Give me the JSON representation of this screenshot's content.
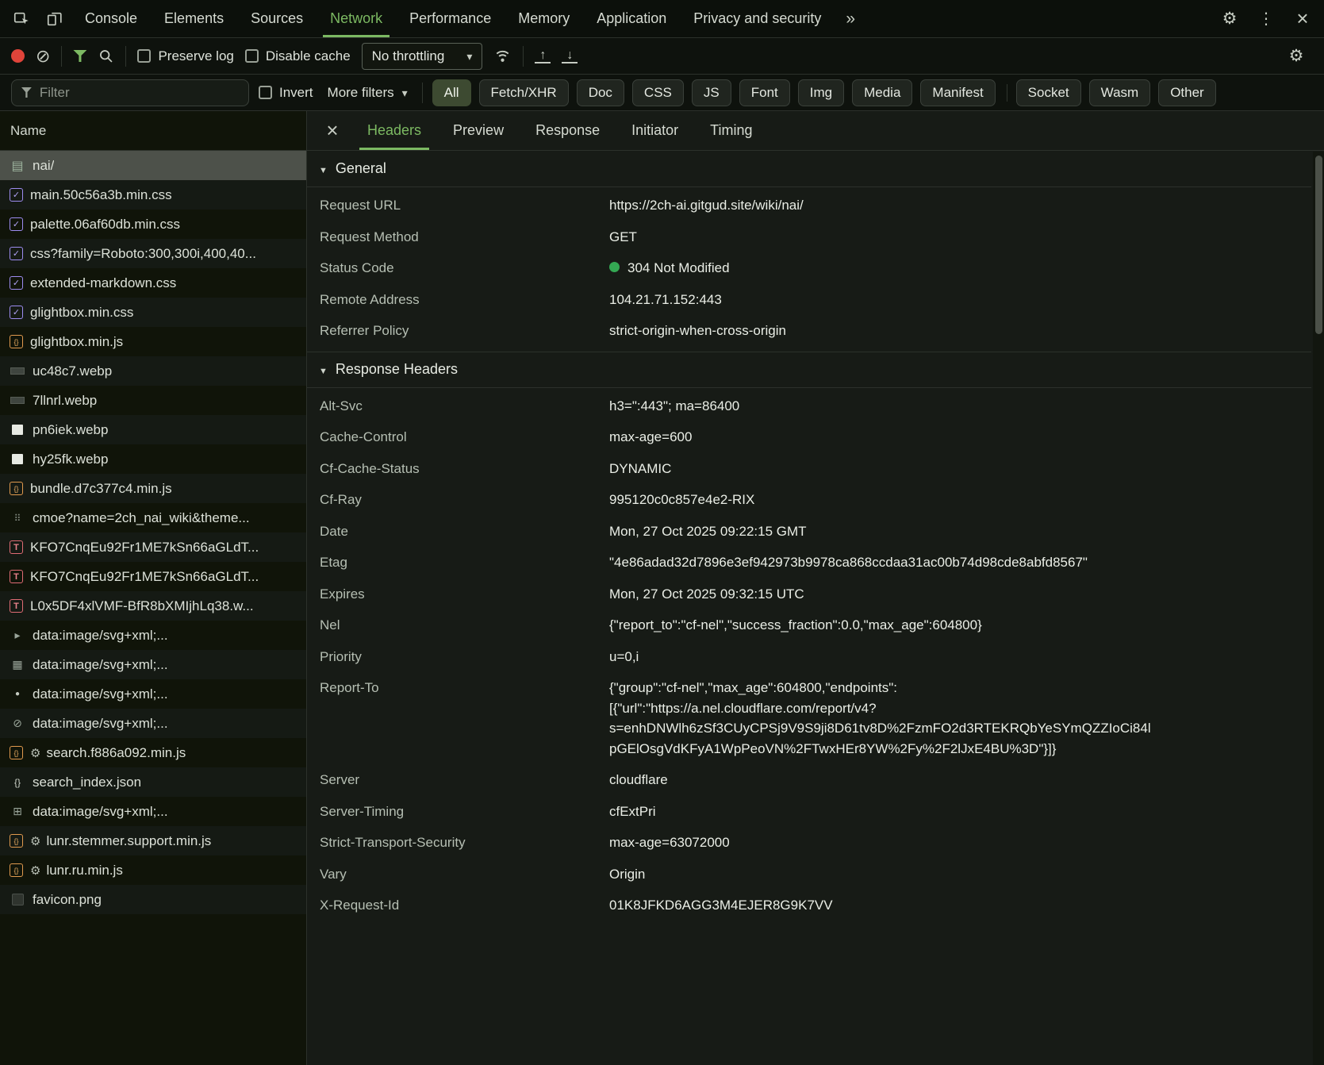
{
  "colors": {
    "accent_green": "#7cb962",
    "record_red": "#e0443a",
    "status_green": "#34a853",
    "selected_row": "#4d514a"
  },
  "icons": {
    "inspect": "cursor-in-box",
    "device_toolbar": "phone-tablet",
    "record": "filled-red-circle",
    "clear": "circle-slash",
    "filter": "green-funnel",
    "search": "magnifier",
    "network_conditions": "wifi",
    "import_har": "arrow-up-tray",
    "export_har": "arrow-down-tray",
    "settings": "gear",
    "more_options": "kebab",
    "close": "x",
    "section_caret": "triangle-down"
  },
  "top_bar": {
    "tabs": [
      {
        "label": "Console"
      },
      {
        "label": "Elements"
      },
      {
        "label": "Sources"
      },
      {
        "label": "Network",
        "active": true
      },
      {
        "label": "Performance"
      },
      {
        "label": "Memory"
      },
      {
        "label": "Application"
      },
      {
        "label": "Privacy and security"
      }
    ]
  },
  "network_toolbar": {
    "preserve_log_label": "Preserve log",
    "disable_cache_label": "Disable cache",
    "throttling_value": "No throttling"
  },
  "filter_bar": {
    "filter_placeholder": "Filter",
    "invert_label": "Invert",
    "more_filters_label": "More filters",
    "type_filters": [
      {
        "label": "All",
        "active": true
      },
      {
        "label": "Fetch/XHR"
      },
      {
        "label": "Doc"
      },
      {
        "label": "CSS"
      },
      {
        "label": "JS"
      },
      {
        "label": "Font"
      },
      {
        "label": "Img"
      },
      {
        "label": "Media"
      },
      {
        "label": "Manifest"
      },
      {
        "label": "Socket",
        "divided": true
      },
      {
        "label": "Wasm"
      },
      {
        "label": "Other"
      }
    ]
  },
  "request_list": {
    "name_header": "Name",
    "items": [
      {
        "name": "nai/",
        "icon": "document-icon",
        "selected": true
      },
      {
        "name": "main.50c56a3b.min.css",
        "icon": "stylesheet-icon"
      },
      {
        "name": "palette.06af60db.min.css",
        "icon": "stylesheet-icon"
      },
      {
        "name": "css?family=Roboto:300,300i,400,40...",
        "icon": "stylesheet-icon"
      },
      {
        "name": "extended-markdown.css",
        "icon": "stylesheet-icon"
      },
      {
        "name": "glightbox.min.css",
        "icon": "stylesheet-icon"
      },
      {
        "name": "glightbox.min.js",
        "icon": "script-icon"
      },
      {
        "name": "uc48c7.webp",
        "icon": "image-thumb-dark-icon"
      },
      {
        "name": "7llnrl.webp",
        "icon": "image-thumb-dark-icon"
      },
      {
        "name": "pn6iek.webp",
        "icon": "image-thumb-light-icon"
      },
      {
        "name": "hy25fk.webp",
        "icon": "image-thumb-light-icon"
      },
      {
        "name": "bundle.d7c377c4.min.js",
        "icon": "script-icon"
      },
      {
        "name": "cmoe?name=2ch_nai_wiki&theme...",
        "icon": "misc-file-icon"
      },
      {
        "name": "KFO7CnqEu92Fr1ME7kSn66aGLdT...",
        "icon": "font-icon"
      },
      {
        "name": "KFO7CnqEu92Fr1ME7kSn66aGLdT...",
        "icon": "font-icon"
      },
      {
        "name": "L0x5DF4xlVMF-BfR8bXMIjhLq38.w...",
        "icon": "font-icon"
      },
      {
        "name": "data:image/svg+xml;...",
        "icon": "svg-arrow-icon"
      },
      {
        "name": "data:image/svg+xml;...",
        "icon": "svg-grid-icon"
      },
      {
        "name": "data:image/svg+xml;...",
        "icon": "svg-circle-icon"
      },
      {
        "name": "data:image/svg+xml;...",
        "icon": "svg-slash-icon"
      },
      {
        "name": "search.f886a092.min.js",
        "icon": "script-icon",
        "gear": true
      },
      {
        "name": "search_index.json",
        "icon": "json-icon"
      },
      {
        "name": "data:image/svg+xml;...",
        "icon": "copy-icon"
      },
      {
        "name": "lunr.stemmer.support.min.js",
        "icon": "script-icon",
        "gear": true
      },
      {
        "name": "lunr.ru.min.js",
        "icon": "script-icon",
        "gear": true
      },
      {
        "name": "favicon.png",
        "icon": "favicon-icon"
      }
    ]
  },
  "details": {
    "tabs": [
      {
        "label": "Headers",
        "active": true
      },
      {
        "label": "Preview"
      },
      {
        "label": "Response"
      },
      {
        "label": "Initiator"
      },
      {
        "label": "Timing"
      }
    ],
    "sections": [
      {
        "title": "General",
        "rows": [
          {
            "name": "Request URL",
            "value": "https://2ch-ai.gitgud.site/wiki/nai/"
          },
          {
            "name": "Request Method",
            "value": "GET"
          },
          {
            "name": "Status Code",
            "value": "304 Not Modified",
            "dot": true
          },
          {
            "name": "Remote Address",
            "value": "104.21.71.152:443"
          },
          {
            "name": "Referrer Policy",
            "value": "strict-origin-when-cross-origin"
          }
        ]
      },
      {
        "title": "Response Headers",
        "rows": [
          {
            "name": "Alt-Svc",
            "value": "h3=\":443\"; ma=86400"
          },
          {
            "name": "Cache-Control",
            "value": "max-age=600"
          },
          {
            "name": "Cf-Cache-Status",
            "value": "DYNAMIC"
          },
          {
            "name": "Cf-Ray",
            "value": "995120c0c857e4e2-RIX"
          },
          {
            "name": "Date",
            "value": "Mon, 27 Oct 2025 09:22:15 GMT"
          },
          {
            "name": "Etag",
            "value": "\"4e86adad32d7896e3ef942973b9978ca868ccdaa31ac00b74d98cde8abfd8567\""
          },
          {
            "name": "Expires",
            "value": "Mon, 27 Oct 2025 09:32:15 UTC"
          },
          {
            "name": "Nel",
            "value": "{\"report_to\":\"cf-nel\",\"success_fraction\":0.0,\"max_age\":604800}"
          },
          {
            "name": "Priority",
            "value": "u=0,i"
          },
          {
            "name": "Report-To",
            "value": "{\"group\":\"cf-nel\",\"max_age\":604800,\"endpoints\":[{\"url\":\"https://a.nel.cloudflare.com/report/v4?s=enhDNWlh6zSf3CUyCPSj9V9S9ji8D61tv8D%2FzmFO2d3RTEKRQbYeSYmQZZIoCi84lpGElOsgVdKFyA1WpPeoVN%2FTwxHEr8YW%2Fy%2F2lJxE4BU%3D\"}]}"
          },
          {
            "name": "Server",
            "value": "cloudflare"
          },
          {
            "name": "Server-Timing",
            "value": "cfExtPri"
          },
          {
            "name": "Strict-Transport-Security",
            "value": "max-age=63072000"
          },
          {
            "name": "Vary",
            "value": "Origin"
          },
          {
            "name": "X-Request-Id",
            "value": "01K8JFKD6AGG3M4EJER8G9K7VV"
          }
        ]
      }
    ]
  }
}
